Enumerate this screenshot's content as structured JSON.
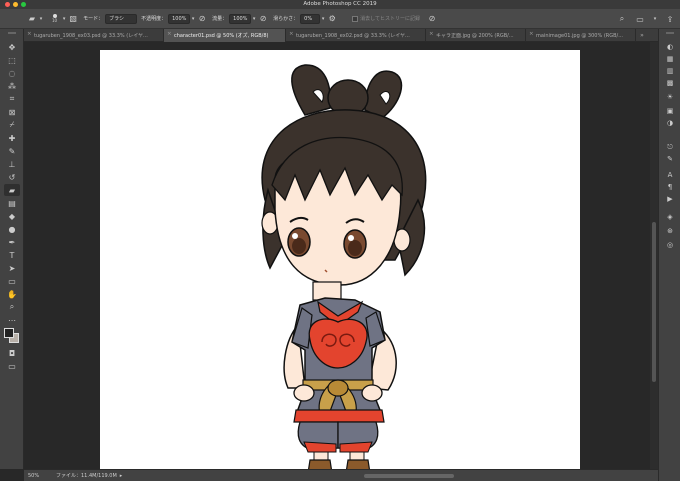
{
  "window": {
    "title": "Adobe Photoshop CC 2019",
    "buttons": [
      {
        "name": "close",
        "color": "#ff5f57"
      },
      {
        "name": "minimize",
        "color": "#febc2e"
      },
      {
        "name": "zoom",
        "color": "#28c840"
      }
    ]
  },
  "options_bar": {
    "brush_size": "10",
    "mode_label": "モード：",
    "mode_value": "ブラシ",
    "opacity_label": "不透明度：",
    "opacity_value": "100%",
    "flow_label": "流量：",
    "flow_value": "100%",
    "smoothing_label": "滑らかさ：",
    "smoothing_value": "0%",
    "history_label": "消去してヒストリーに記録"
  },
  "tabs": [
    {
      "label": "tugaruben_1908_ex03.psd @ 33.3% (レイヤ...",
      "active": false
    },
    {
      "label": "character01.psd @ 50% (オズ, RGB/8)",
      "active": true
    },
    {
      "label": "tugaruben_1908_ex02.psd @ 33.3% (レイヤ...",
      "active": false
    },
    {
      "label": "キャラ正面.jpg @ 200% (RGB/...",
      "active": false
    },
    {
      "label": "mainimage01.jpg @ 300% (RGB/...",
      "active": false
    }
  ],
  "tools": [
    {
      "name": "move-tool-icon",
      "glyph": "✥"
    },
    {
      "name": "marquee-tool-icon",
      "glyph": "⬚"
    },
    {
      "name": "lasso-tool-icon",
      "glyph": "◌"
    },
    {
      "name": "magic-wand-tool-icon",
      "glyph": "⁂"
    },
    {
      "name": "crop-tool-icon",
      "glyph": "⌗"
    },
    {
      "name": "frame-tool-icon",
      "glyph": "⊠"
    },
    {
      "name": "eyedropper-tool-icon",
      "glyph": "⌿"
    },
    {
      "name": "healing-brush-tool-icon",
      "glyph": "✚"
    },
    {
      "name": "brush-tool-icon",
      "glyph": "✎"
    },
    {
      "name": "stamp-tool-icon",
      "glyph": "⊥"
    },
    {
      "name": "history-brush-tool-icon",
      "glyph": "↺"
    },
    {
      "name": "eraser-tool-icon",
      "glyph": "▰"
    },
    {
      "name": "gradient-tool-icon",
      "glyph": "▤"
    },
    {
      "name": "blur-tool-icon",
      "glyph": "◆"
    },
    {
      "name": "dodge-tool-icon",
      "glyph": "●"
    },
    {
      "name": "pen-tool-icon",
      "glyph": "✒"
    },
    {
      "name": "type-tool-icon",
      "glyph": "T"
    },
    {
      "name": "path-selection-tool-icon",
      "glyph": "➤"
    },
    {
      "name": "shape-tool-icon",
      "glyph": "▭"
    },
    {
      "name": "hand-tool-icon",
      "glyph": "✋"
    },
    {
      "name": "zoom-tool-icon",
      "glyph": "⌕"
    },
    {
      "name": "more-tools-icon",
      "glyph": "⋯"
    }
  ],
  "colors": {
    "foreground": "#222222",
    "background": "#b8b0a8"
  },
  "right_panel_icons": [
    {
      "name": "color-panel-icon",
      "glyph": "◐"
    },
    {
      "name": "swatches-panel-icon",
      "glyph": "▦"
    },
    {
      "name": "gradients-panel-icon",
      "glyph": "▥"
    },
    {
      "name": "patterns-panel-icon",
      "glyph": "▩"
    },
    {
      "name": "learn-panel-icon",
      "glyph": "☀"
    },
    {
      "name": "libraries-panel-icon",
      "glyph": "▣"
    },
    {
      "name": "adjustments-panel-icon",
      "glyph": "◑"
    },
    {
      "name": "brush-settings-panel-icon",
      "glyph": "⎋"
    },
    {
      "name": "brushes-panel-icon",
      "glyph": "✎"
    },
    {
      "name": "character-panel-icon",
      "glyph": "A"
    },
    {
      "name": "paragraph-panel-icon",
      "glyph": "¶"
    },
    {
      "name": "actions-panel-icon",
      "glyph": "▶"
    },
    {
      "name": "layers-panel-icon",
      "glyph": "◈"
    },
    {
      "name": "channels-panel-icon",
      "glyph": "⊛"
    },
    {
      "name": "paths-panel-icon",
      "glyph": "◎"
    }
  ],
  "status_bar": {
    "zoom": "50%",
    "file_info": "ファイル：11.4M/119.0M"
  }
}
